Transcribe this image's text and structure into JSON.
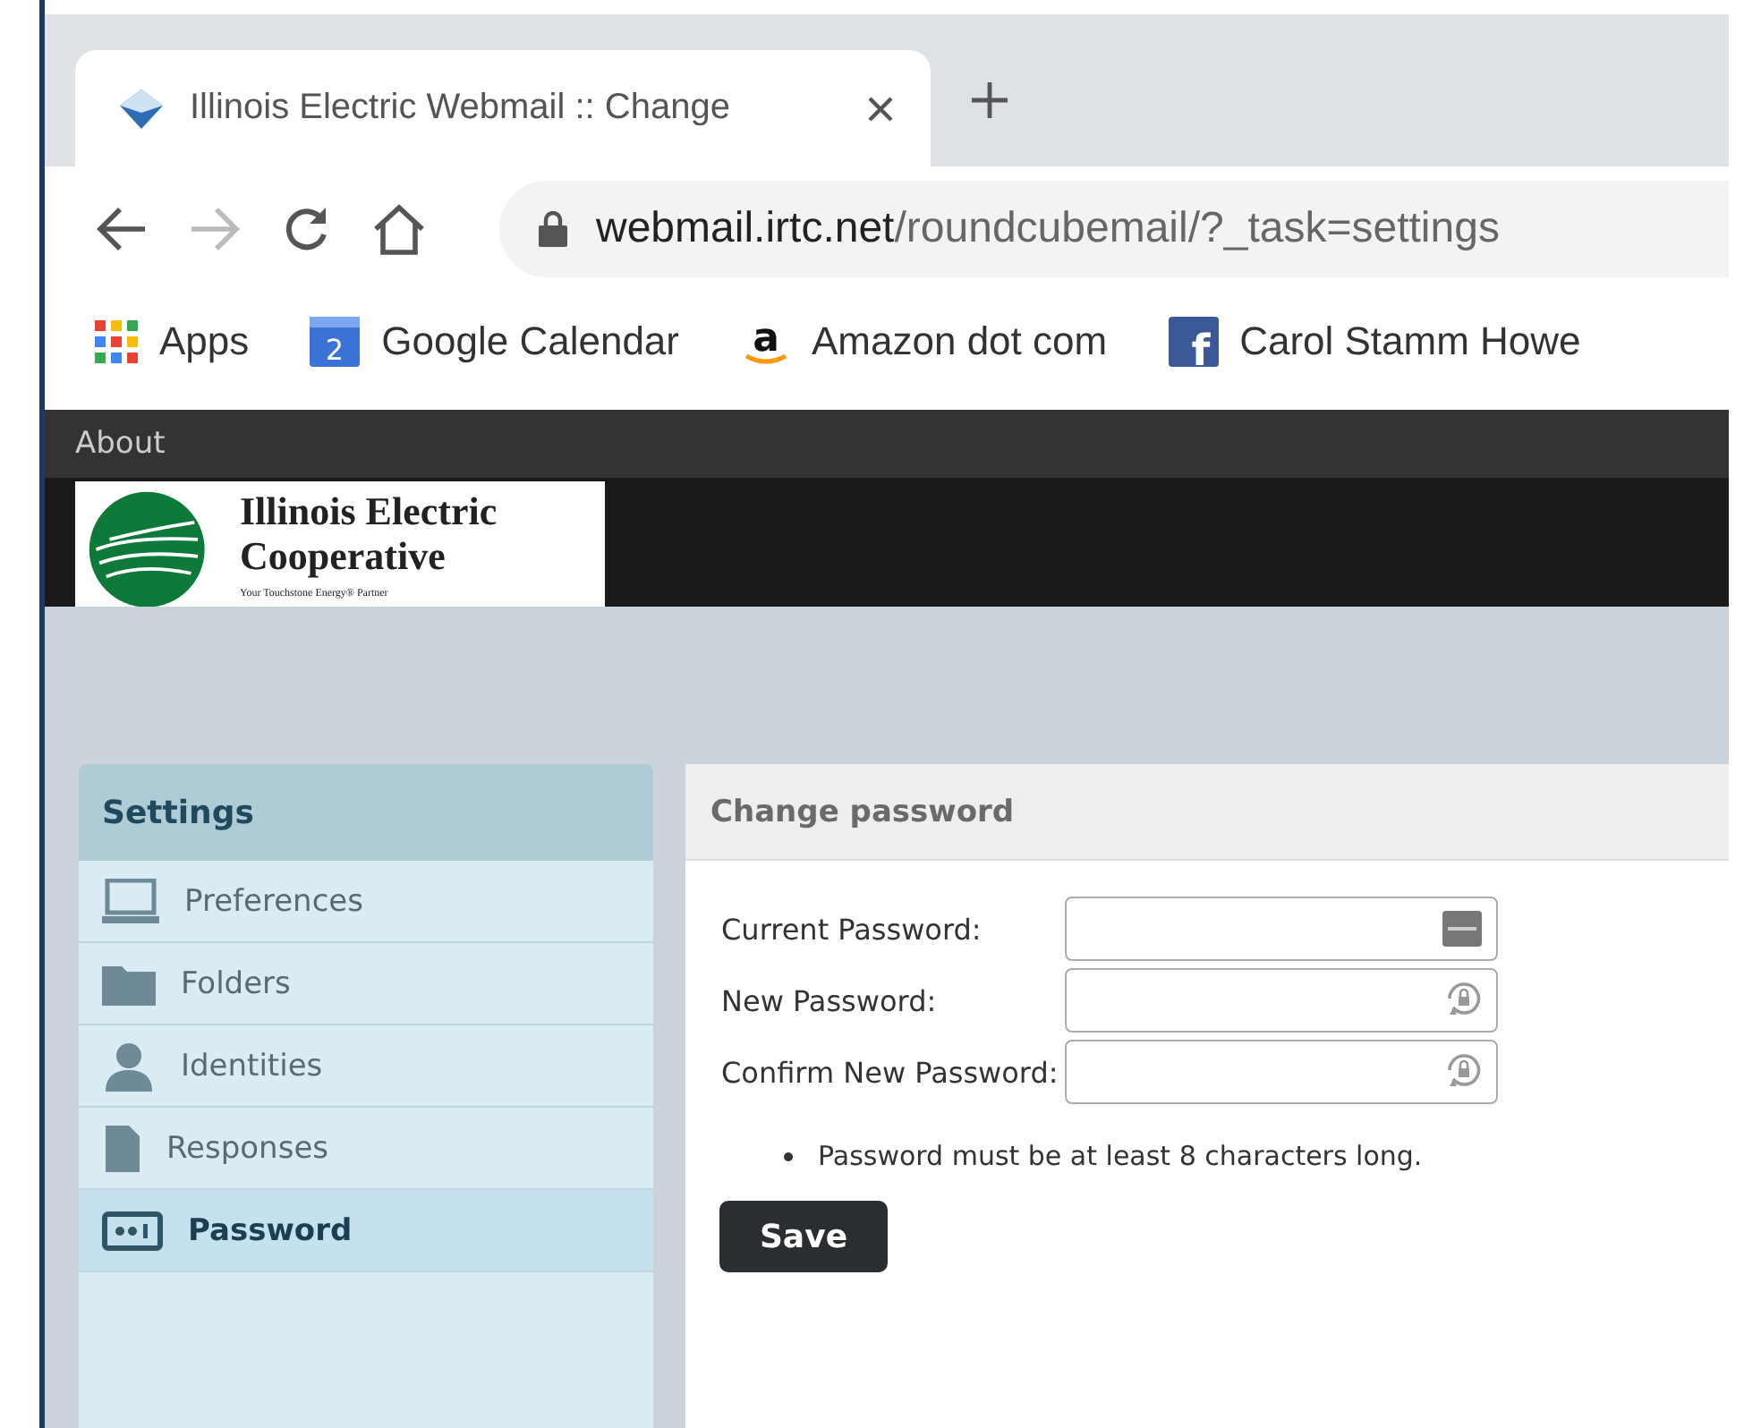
{
  "browser": {
    "tab": {
      "title": "Illinois Electric Webmail :: Change"
    },
    "url": {
      "host": "webmail.irtc.net",
      "path": "/roundcubemail/?_task=settings"
    },
    "bookmarks": [
      {
        "kind": "apps",
        "label": "Apps"
      },
      {
        "kind": "calendar",
        "label": "Google Calendar",
        "badge": "2"
      },
      {
        "kind": "amazon",
        "label": "Amazon dot com",
        "badge": "a"
      },
      {
        "kind": "facebook",
        "label": "Carol Stamm Howe",
        "badge": "f"
      }
    ]
  },
  "topbar": {
    "link": "About"
  },
  "logo": {
    "line1": "Illinois Electric",
    "line2": "Cooperative",
    "tagline": "Your Touchstone Energy® Partner"
  },
  "sidebar": {
    "title": "Settings",
    "items": [
      {
        "kind": "preferences",
        "label": "Preferences",
        "selected": false
      },
      {
        "kind": "folders",
        "label": "Folders",
        "selected": false
      },
      {
        "kind": "identities",
        "label": "Identities",
        "selected": false
      },
      {
        "kind": "responses",
        "label": "Responses",
        "selected": false
      },
      {
        "kind": "password",
        "label": "Password",
        "selected": true
      }
    ]
  },
  "panel": {
    "title": "Change password",
    "fields": [
      {
        "label": "Current Password:",
        "kind": "keyboard"
      },
      {
        "label": "New Password:",
        "kind": "generate"
      },
      {
        "label": "Confirm New Password:",
        "kind": "generate"
      }
    ],
    "hint": "Password must be at least 8 characters long.",
    "button": "Save"
  }
}
